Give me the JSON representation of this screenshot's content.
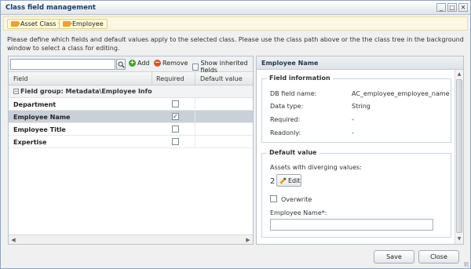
{
  "window": {
    "title": "Class field management",
    "controls": [
      "_",
      "□",
      "✕"
    ]
  },
  "breadcrumb": {
    "items": [
      {
        "label": "Asset Class",
        "caret": "▾"
      },
      {
        "label": "Employee"
      }
    ]
  },
  "info_text": "Please define which fields and default values apply to the selected class. Please use the class path above or the the class tree in the background window to select a class for editing.",
  "toolbar": {
    "search_placeholder": "",
    "add_label": "Add",
    "remove_label": "Remove",
    "show_inherited_label": "Show inherited fields"
  },
  "grid": {
    "columns": [
      "Field",
      "Required",
      "Default value"
    ],
    "group_label": "Field group: Metadata\\Employee Info",
    "rows": [
      {
        "name": "Department",
        "required": false,
        "selected": false
      },
      {
        "name": "Employee Name",
        "required": true,
        "selected": true
      },
      {
        "name": "Employee Title",
        "required": false,
        "selected": false
      },
      {
        "name": "Expertise",
        "required": false,
        "selected": false
      }
    ]
  },
  "detail": {
    "header": "Employee Name",
    "field_info": {
      "legend": "Field information",
      "db_field_label": "DB field name:",
      "db_field_value": "AC_employee_employee_name",
      "data_type_label": "Data type:",
      "data_type_value": "String",
      "required_label": "Required:",
      "required_value": "-",
      "readonly_label": "Readonly:",
      "readonly_value": "-"
    },
    "default_value": {
      "legend": "Default value",
      "diverging_label": "Assets with diverging values:",
      "diverging_count": "2",
      "edit_label": "Edit",
      "overwrite_label": "Overwrite",
      "field_label": "Employee Name*:",
      "field_value": ""
    }
  },
  "footer": {
    "save_label": "Save",
    "close_label": "Close"
  }
}
